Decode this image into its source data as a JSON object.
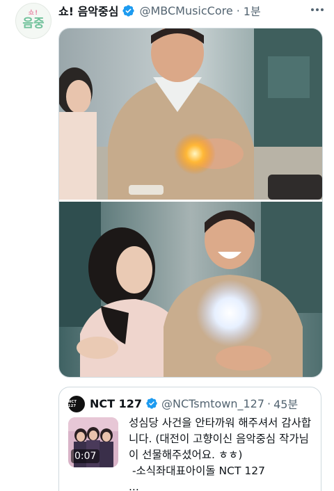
{
  "tweet": {
    "account_avatar_text_top": "쇼!",
    "account_avatar_text_main": "음중",
    "display_name": "쇼! 음악중심",
    "handle": "@MBCMusicCore",
    "separator": "·",
    "time": "1분",
    "verified": true
  },
  "media": {
    "photos": [
      {
        "kind": "drama-still",
        "description_icon": "photo-1"
      },
      {
        "kind": "drama-still",
        "description_icon": "photo-2"
      }
    ]
  },
  "quoted_tweet": {
    "avatar_text": "NCT 127",
    "display_name": "NCT 127",
    "handle": "@NCTsmtown_127",
    "separator": "·",
    "time": "45분",
    "verified": true,
    "video_duration": "0:07",
    "text": "성심당 사건을 안타까워 해주셔서 감사합니다. (대전이 고향이신 음악중심 작가님이 선물해주셨어요. ㅎㅎ)\n -소식좌대표아이돌 NCT 127\n..."
  },
  "colors": {
    "verified_blue": "#1d9bf0",
    "text_primary": "#0f1419",
    "text_secondary": "#536471",
    "border": "#cfd9de"
  }
}
